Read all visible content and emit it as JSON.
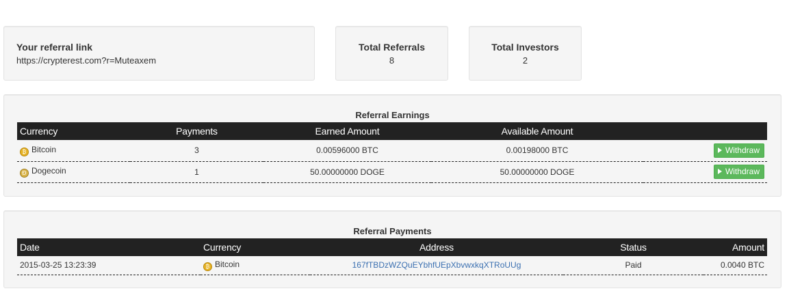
{
  "referral": {
    "title": "Your referral link",
    "link": "https://crypterest.com?r=Muteaxem"
  },
  "total_referrals": {
    "title": "Total Referrals",
    "value": "8"
  },
  "total_investors": {
    "title": "Total Investors",
    "value": "2"
  },
  "earnings": {
    "title": "Referral Earnings",
    "headers": {
      "currency": "Currency",
      "payments": "Payments",
      "earned": "Earned Amount",
      "available": "Available Amount"
    },
    "rows": [
      {
        "currency": "Bitcoin",
        "icon": "bitcoin-icon",
        "payments": "3",
        "earned": "0.00596000 BTC",
        "available": "0.00198000 BTC",
        "action": "Withdraw"
      },
      {
        "currency": "Dogecoin",
        "icon": "dogecoin-icon",
        "payments": "1",
        "earned": "50.00000000 DOGE",
        "available": "50.00000000 DOGE",
        "action": "Withdraw"
      }
    ]
  },
  "payments": {
    "title": "Referral Payments",
    "headers": {
      "date": "Date",
      "currency": "Currency",
      "address": "Address",
      "status": "Status",
      "amount": "Amount"
    },
    "rows": [
      {
        "date": "2015-03-25 13:23:39",
        "currency": "Bitcoin",
        "icon": "bitcoin-icon",
        "address": "167fTBDzWZQuEYbhfUEpXbvwxkqXTRoUUg",
        "status": "Paid",
        "amount": "0.0040 BTC"
      }
    ]
  },
  "colors": {
    "header_bg": "#222222",
    "card_bg": "#f5f5f5",
    "withdraw_green": "#5cb85c",
    "link_blue": "#3a6fb0"
  }
}
